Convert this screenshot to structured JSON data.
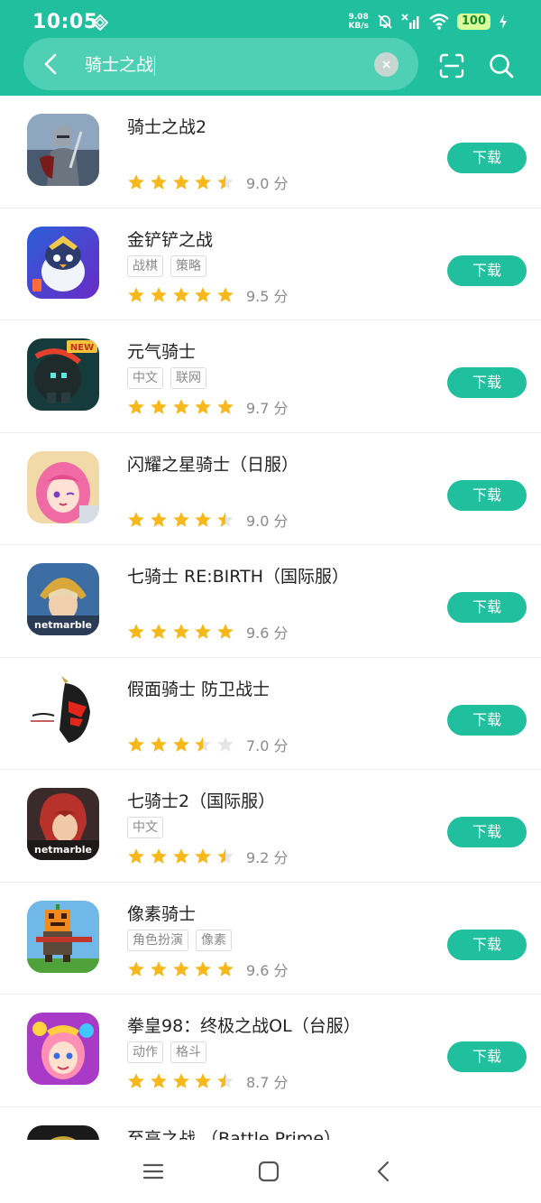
{
  "status": {
    "time": "10:05",
    "speed_value": "9.08",
    "speed_unit": "KB/s",
    "battery": "100"
  },
  "search": {
    "query": "骑士之战",
    "score_unit": "分"
  },
  "apps": [
    {
      "name": "骑士之战2",
      "tags": [],
      "score": "9.0",
      "rating": 4.5,
      "action": "下载",
      "icon": "knight-armor-icon"
    },
    {
      "name": "金铲铲之战",
      "tags": [
        "战棋",
        "策略"
      ],
      "score": "9.5",
      "rating": 5,
      "action": "下载",
      "icon": "penguin-icon"
    },
    {
      "name": "元气骑士",
      "tags": [
        "中文",
        "联网"
      ],
      "score": "9.7",
      "rating": 5,
      "action": "下载",
      "icon": "soul-knight-icon"
    },
    {
      "name": "闪耀之星骑士（日服）",
      "tags": [],
      "score": "9.0",
      "rating": 4.5,
      "action": "下载",
      "icon": "anime-girl-icon"
    },
    {
      "name": "七骑士 RE:BIRTH（国际服）",
      "tags": [],
      "score": "9.6",
      "rating": 5,
      "action": "下载",
      "icon": "netmarble-knight-icon"
    },
    {
      "name": "假面骑士 防卫战士",
      "tags": [],
      "score": "7.0",
      "rating": 3.5,
      "action": "下载",
      "icon": "kamen-rider-icon"
    },
    {
      "name": "七骑士2（国际服）",
      "tags": [
        "中文"
      ],
      "score": "9.2",
      "rating": 4.5,
      "action": "下载",
      "icon": "netmarble-redhair-icon"
    },
    {
      "name": "像素骑士",
      "tags": [
        "角色扮演",
        "像素"
      ],
      "score": "9.6",
      "rating": 5,
      "action": "下载",
      "icon": "pixel-pumpkin-icon"
    },
    {
      "name": "拳皇98：终极之战OL（台服）",
      "tags": [
        "动作",
        "格斗"
      ],
      "score": "8.7",
      "rating": 4.5,
      "action": "下载",
      "icon": "kof-girl-icon"
    },
    {
      "name": "至高之战 （Battle Prime）",
      "tags": [],
      "score": "",
      "rating": 0,
      "action": "",
      "icon": "battle-prime-icon"
    }
  ],
  "colors": {
    "accent": "#20bf9d",
    "star": "#f6b81a",
    "star_empty": "#e6e6e6"
  },
  "icon_labels": {
    "netmarble": "netmarble",
    "new_badge": "NEW"
  }
}
